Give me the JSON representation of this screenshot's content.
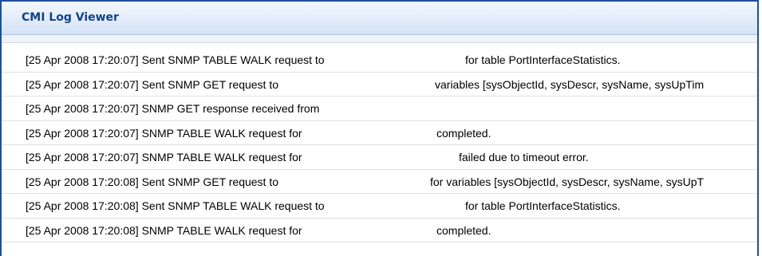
{
  "window": {
    "title": "CMI Log Viewer"
  },
  "log_entries": [
    {
      "prefix": "[25 Apr 2008 17:20:07] Sent SNMP TABLE WALK request to",
      "suffix": "for table PortInterfaceStatistics."
    },
    {
      "prefix": "[25 Apr 2008 17:20:07] Sent SNMP GET request to",
      "suffix": "variables [sysObjectId, sysDescr, sysName, sysUpTim"
    },
    {
      "prefix": "[25 Apr 2008 17:20:07] SNMP GET response received from",
      "suffix": ""
    },
    {
      "prefix": "[25 Apr 2008 17:20:07] SNMP TABLE WALK request for",
      "suffix": "completed."
    },
    {
      "prefix": "[25 Apr 2008 17:20:07] SNMP TABLE WALK request for",
      "suffix": "failed due to timeout error."
    },
    {
      "prefix": "[25 Apr 2008 17:20:08] Sent SNMP GET request to",
      "suffix": "for variables [sysObjectId, sysDescr, sysName, sysUpT"
    },
    {
      "prefix": "[25 Apr 2008 17:20:08] Sent SNMP TABLE WALK request to",
      "suffix": "for table PortInterfaceStatistics."
    },
    {
      "prefix": "[25 Apr 2008 17:20:08] SNMP TABLE WALK request for",
      "suffix": "completed."
    }
  ]
}
